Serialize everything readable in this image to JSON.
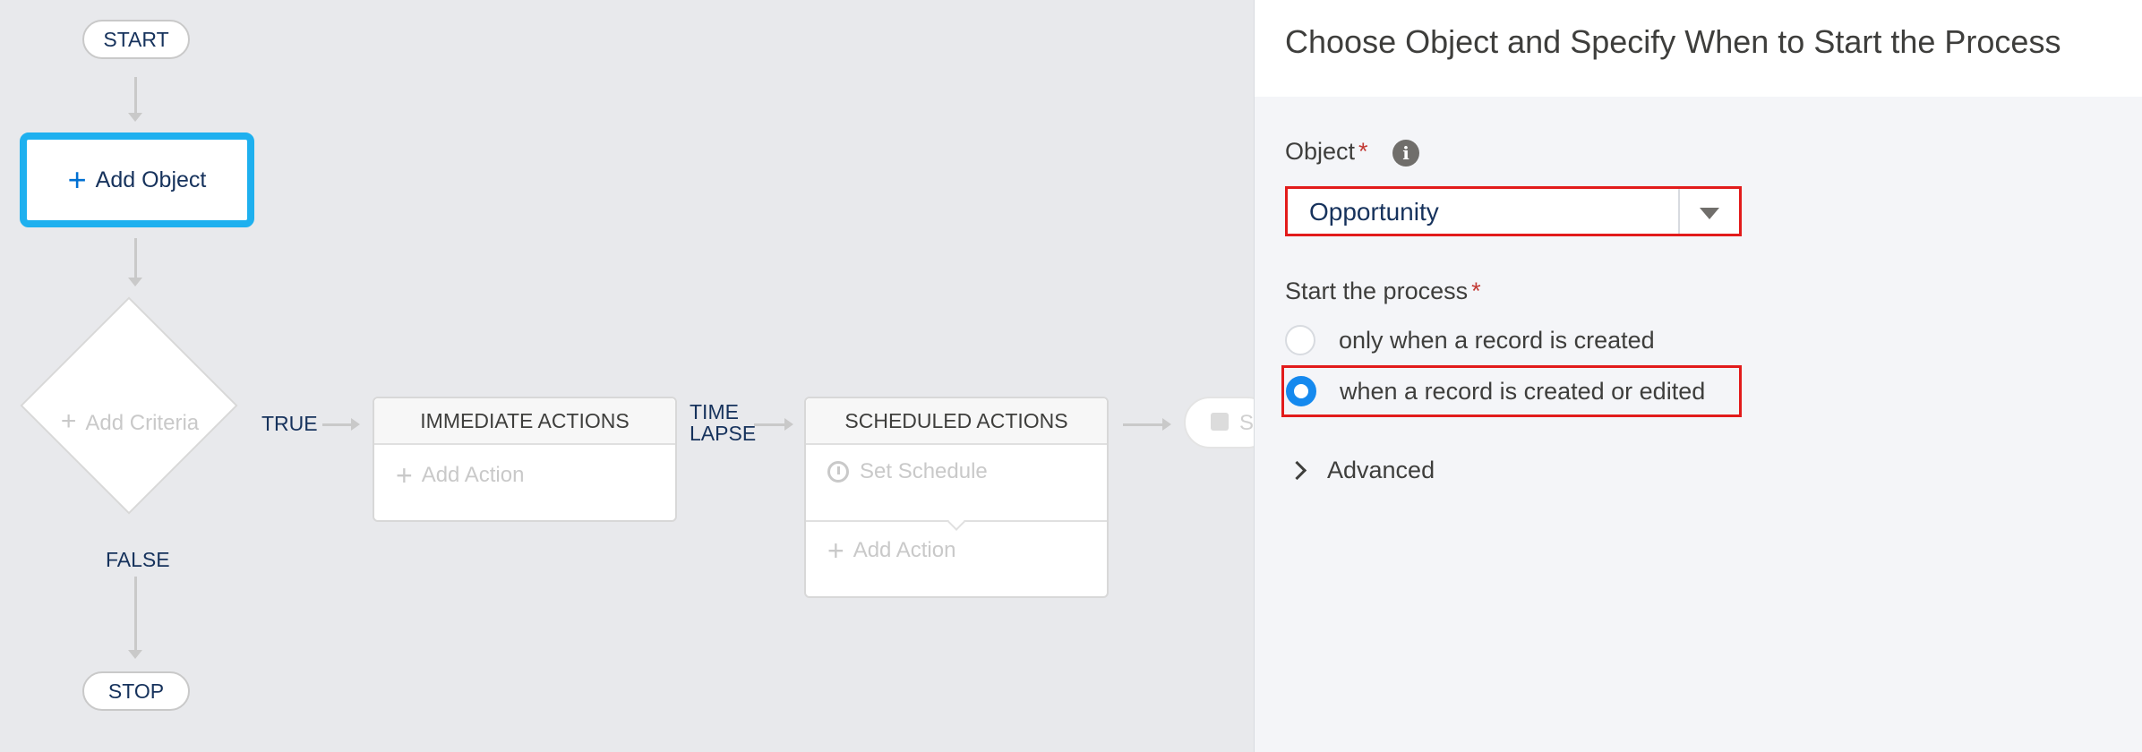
{
  "canvas": {
    "start_label": "START",
    "add_object_label": "Add Object",
    "add_criteria_label": "Add Criteria",
    "true_label": "TRUE",
    "false_label": "FALSE",
    "stop_label": "STOP",
    "immediate_actions": {
      "title": "IMMEDIATE ACTIONS",
      "add_action_label": "Add Action"
    },
    "time_lapse_label_line1": "TIME",
    "time_lapse_label_line2": "LAPSE",
    "scheduled_actions": {
      "title": "SCHEDULED ACTIONS",
      "set_schedule_label": "Set Schedule",
      "add_action_label": "Add Action"
    },
    "partial_node_letter": "S"
  },
  "panel": {
    "title": "Choose Object and Specify When to Start the Process",
    "object_label": "Object",
    "required_mark": "*",
    "object_value": "Opportunity",
    "start_label": "Start the process",
    "options": [
      {
        "label": "only when a record is created",
        "checked": false
      },
      {
        "label": "when a record is created or edited",
        "checked": true
      }
    ],
    "advanced_label": "Advanced"
  },
  "colors": {
    "accent_blue": "#1eb0ef",
    "radio_blue": "#1589ee",
    "highlight_red": "#e21b1b",
    "required_red": "#c23934"
  }
}
